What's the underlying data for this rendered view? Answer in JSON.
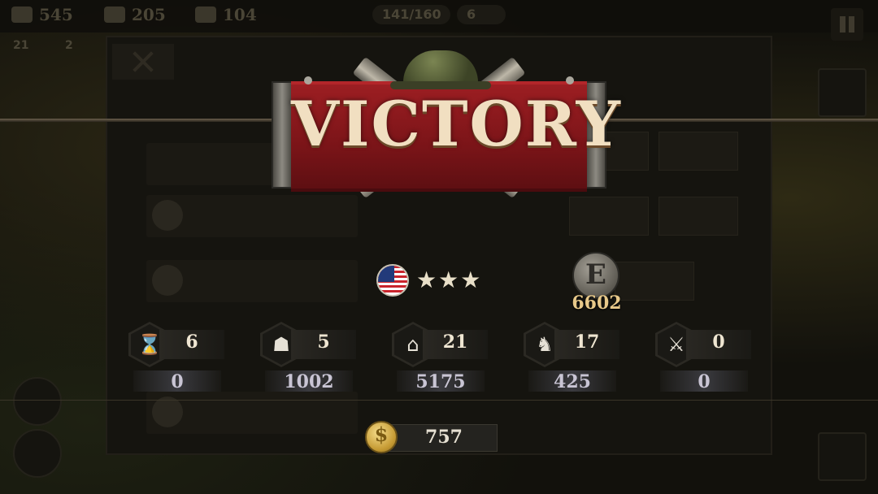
{
  "background": {
    "top_resources": [
      {
        "icon": "helmet-icon",
        "value": "545"
      },
      {
        "icon": "oil-icon",
        "value": "205"
      },
      {
        "icon": "steel-icon",
        "value": "104"
      }
    ],
    "population": "141/160",
    "population_extra": "6",
    "sub_resources": [
      "21",
      "2"
    ]
  },
  "banner": {
    "title": "VICTORY",
    "colors": {
      "cloth": "#8c1a1e",
      "text": "#f1dfc1"
    }
  },
  "result": {
    "flag_icon": "us-flag-icon",
    "stars": "★★★",
    "medal_icon": "experience-medal-icon",
    "medal_letter": "E",
    "experience": "6602"
  },
  "stats": [
    {
      "icon": "hourglass-icon",
      "glyph": "⌛",
      "top": "6",
      "bottom": "0"
    },
    {
      "icon": "officer-cap-icon",
      "glyph": "☗",
      "top": "5",
      "bottom": "1002"
    },
    {
      "icon": "city-building-icon",
      "glyph": "⌂",
      "top": "21",
      "bottom": "5175"
    },
    {
      "icon": "soldier-icon",
      "glyph": "♞",
      "top": "17",
      "bottom": "425"
    },
    {
      "icon": "crossed-swords-plus-icon",
      "glyph": "⚔",
      "top": "0",
      "bottom": "0"
    }
  ],
  "reward": {
    "icon": "gold-coin-icon",
    "coin_symbol": "$",
    "value": "757"
  }
}
